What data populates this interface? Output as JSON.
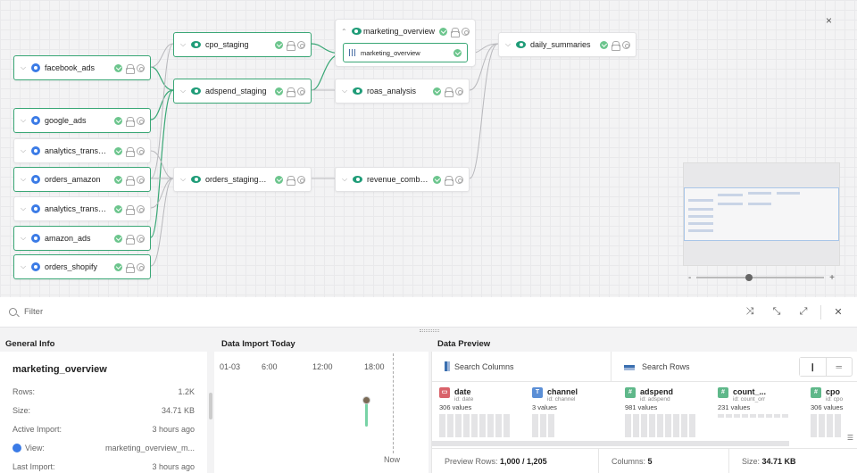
{
  "canvas": {
    "close_label": "×",
    "nodes": {
      "facebook_ads": "facebook_ads",
      "google_ads": "google_ads",
      "analytics_1": "analytics_transact...",
      "orders_amazon": "orders_amazon",
      "analytics_2": "analytics_transact...",
      "amazon_ads": "amazon_ads",
      "orders_shopify": "orders_shopify",
      "cpo_staging": "cpo_staging",
      "adspend_staging": "adspend_staging",
      "orders_staging": "orders_staging_coh...",
      "marketing_overview": "marketing_overview",
      "marketing_overview_table": "marketing_overview",
      "roas_analysis": "roas_analysis",
      "revenue_combined": "revenue_combined",
      "daily_summaries": "daily_summaries"
    },
    "zoom": {
      "minus": "-",
      "plus": "+",
      "level": 0.38
    },
    "colors": {
      "highlight": "#3aa776",
      "source": "#3b7be6",
      "view": "#1f9c78"
    }
  },
  "filterbar": {
    "placeholder": "Filter",
    "close": "✕"
  },
  "general_info": {
    "heading": "General Info",
    "title": "marketing_overview",
    "rows": [
      {
        "key": "Rows:",
        "value": "1.2K"
      },
      {
        "key": "Size:",
        "value": "34.71 KB"
      },
      {
        "key": "Active Import:",
        "value": "3 hours ago"
      },
      {
        "key": "View:",
        "value": "marketing_overview_m..."
      },
      {
        "key": "Last Import:",
        "value": "3 hours ago"
      }
    ]
  },
  "data_import": {
    "heading": "Data Import Today",
    "ticks": [
      "01-03",
      "6:00",
      "12:00",
      "18:00"
    ],
    "now_label": "Now"
  },
  "data_preview": {
    "heading": "Data Preview",
    "search_columns": "Search Columns",
    "search_rows": "Search Rows",
    "columns": [
      {
        "name": "date",
        "id": "id: date",
        "count": "306 values",
        "badge": "▭",
        "color": "#d9626a"
      },
      {
        "name": "channel",
        "id": "id: channel",
        "count": "3 values",
        "badge": "T",
        "color": "#5b8fd6"
      },
      {
        "name": "adspend",
        "id": "id: adspend",
        "count": "981 values",
        "badge": "#",
        "color": "#5fb88a"
      },
      {
        "name": "count_...",
        "id": "id: count_orr",
        "count": "231 values",
        "badge": "#",
        "color": "#5fb88a"
      },
      {
        "name": "cpo",
        "id": "id: cpo",
        "count": "306 values",
        "badge": "#",
        "color": "#5fb88a"
      }
    ],
    "footer": {
      "preview_label": "Preview Rows:",
      "preview_value": "1,000 / 1,205",
      "columns_label": "Columns:",
      "columns_value": "5",
      "size_label": "Size:",
      "size_value": "34.71 KB"
    }
  }
}
